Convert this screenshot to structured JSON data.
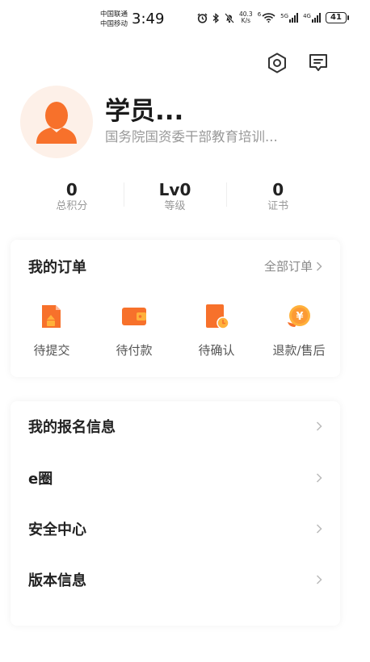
{
  "status_bar": {
    "carrier_1": "中国联通",
    "carrier_2": "中国移动",
    "time": "3:49",
    "net_speed_value": "40.3",
    "net_speed_unit": "K/s",
    "wifi_num": "6",
    "signal_1": "5G",
    "signal_2": "4G",
    "battery": "41"
  },
  "profile": {
    "name": "学员...",
    "organization": "国务院国资委干部教育培训..."
  },
  "stats": [
    {
      "value": "0",
      "label": "总积分"
    },
    {
      "value": "Lv0",
      "label": "等级"
    },
    {
      "value": "0",
      "label": "证书"
    }
  ],
  "orders": {
    "title": "我的订单",
    "all_label": "全部订单",
    "items": [
      {
        "label": "待提交",
        "icon": "submit-document-icon"
      },
      {
        "label": "待付款",
        "icon": "wallet-icon"
      },
      {
        "label": "待确认",
        "icon": "confirm-clock-icon"
      },
      {
        "label": "退款/售后",
        "icon": "refund-coin-icon"
      }
    ]
  },
  "menu": [
    {
      "label": "我的报名信息"
    },
    {
      "label": "e圈"
    },
    {
      "label": "安全中心"
    },
    {
      "label": "版本信息"
    }
  ],
  "colors": {
    "accent": "#f7712b",
    "accent_light": "#ffb13b",
    "avatar_bg": "#fdf0e8",
    "muted_text": "#999999"
  }
}
